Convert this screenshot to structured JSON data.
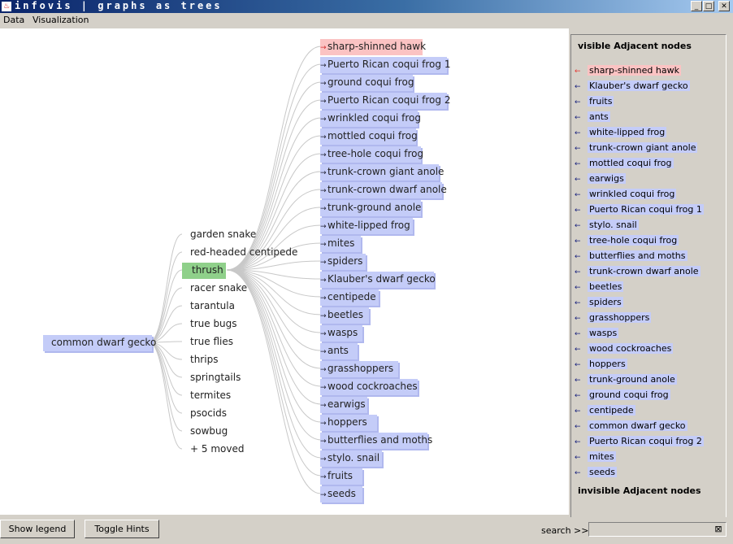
{
  "window": {
    "title": "infovis | graphs as trees"
  },
  "menu": [
    "Data",
    "Visualization"
  ],
  "root": {
    "label": "common dwarf gecko"
  },
  "level1": [
    {
      "label": "garden snake",
      "state": "plain"
    },
    {
      "label": "red-headed centipede",
      "state": "plain"
    },
    {
      "label": "thrush",
      "state": "selected"
    },
    {
      "label": "racer snake",
      "state": "plain"
    },
    {
      "label": "tarantula",
      "state": "plain"
    },
    {
      "label": "true bugs",
      "state": "plain"
    },
    {
      "label": "true flies",
      "state": "plain"
    },
    {
      "label": "thrips",
      "state": "plain"
    },
    {
      "label": "springtails",
      "state": "plain"
    },
    {
      "label": "termites",
      "state": "plain"
    },
    {
      "label": "psocids",
      "state": "plain"
    },
    {
      "label": "sowbug",
      "state": "plain"
    },
    {
      "label": "+ 5 moved",
      "state": "plain"
    }
  ],
  "level2": [
    {
      "label": "sharp-shinned hawk",
      "state": "highlight"
    },
    {
      "label": "Puerto Rican coqui frog 1"
    },
    {
      "label": "ground coqui frog"
    },
    {
      "label": "Puerto Rican coqui frog 2"
    },
    {
      "label": "wrinkled coqui frog"
    },
    {
      "label": "mottled coqui frog"
    },
    {
      "label": "tree-hole coqui frog"
    },
    {
      "label": "trunk-crown giant anole"
    },
    {
      "label": "trunk-crown dwarf anole"
    },
    {
      "label": "trunk-ground anole"
    },
    {
      "label": "white-lipped frog"
    },
    {
      "label": "mites"
    },
    {
      "label": "spiders"
    },
    {
      "label": "Klauber's dwarf gecko"
    },
    {
      "label": "centipede"
    },
    {
      "label": "beetles"
    },
    {
      "label": "wasps"
    },
    {
      "label": "ants"
    },
    {
      "label": "grasshoppers"
    },
    {
      "label": "wood cockroaches"
    },
    {
      "label": "earwigs"
    },
    {
      "label": "hoppers"
    },
    {
      "label": "butterflies and moths"
    },
    {
      "label": "stylo. snail"
    },
    {
      "label": "fruits"
    },
    {
      "label": "seeds"
    }
  ],
  "sidebar": {
    "visible_heading": "visible Adjacent nodes",
    "items": [
      {
        "label": "sharp-shinned hawk",
        "state": "highlight"
      },
      {
        "label": "Klauber's dwarf gecko"
      },
      {
        "label": "fruits"
      },
      {
        "label": "ants"
      },
      {
        "label": "white-lipped frog"
      },
      {
        "label": "trunk-crown giant anole"
      },
      {
        "label": "mottled coqui frog"
      },
      {
        "label": "earwigs"
      },
      {
        "label": "wrinkled coqui frog"
      },
      {
        "label": "Puerto Rican coqui frog 1"
      },
      {
        "label": "stylo. snail"
      },
      {
        "label": "tree-hole coqui frog"
      },
      {
        "label": "butterflies and moths"
      },
      {
        "label": "trunk-crown dwarf anole"
      },
      {
        "label": "beetles"
      },
      {
        "label": "spiders"
      },
      {
        "label": "grasshoppers"
      },
      {
        "label": "wasps"
      },
      {
        "label": "wood cockroaches"
      },
      {
        "label": "hoppers"
      },
      {
        "label": "trunk-ground anole"
      },
      {
        "label": "ground coqui frog"
      },
      {
        "label": "centipede"
      },
      {
        "label": "common dwarf gecko"
      },
      {
        "label": "Puerto Rican coqui frog 2"
      },
      {
        "label": "mites"
      },
      {
        "label": "seeds"
      }
    ],
    "invisible_heading": "invisible Adjacent nodes"
  },
  "bottom": {
    "legend_button": "Show legend",
    "hints_button": "Toggle Hints",
    "search_label": "search >>",
    "search_value": ""
  },
  "colors": {
    "node_blue": "#c4ccf8",
    "node_red": "#fbc3c3",
    "node_green": "#8fd08a"
  },
  "icons": {
    "app": "java-cup-icon",
    "minimize": "minimize-icon",
    "maximize": "maximize-icon",
    "close": "close-icon",
    "clear": "clear-icon",
    "edge_arrow": "arrow-left-icon"
  }
}
